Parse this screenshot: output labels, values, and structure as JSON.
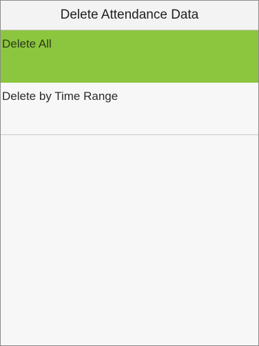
{
  "screen": {
    "title": "Delete Attendance Data"
  },
  "menu": {
    "items": [
      {
        "label": "Delete All",
        "selected": true
      },
      {
        "label": "Delete by Time Range",
        "selected": false
      }
    ]
  },
  "colors": {
    "selected_highlight": "#8cc63f",
    "background": "#f7f7f7",
    "divider": "#c8c8c8"
  }
}
